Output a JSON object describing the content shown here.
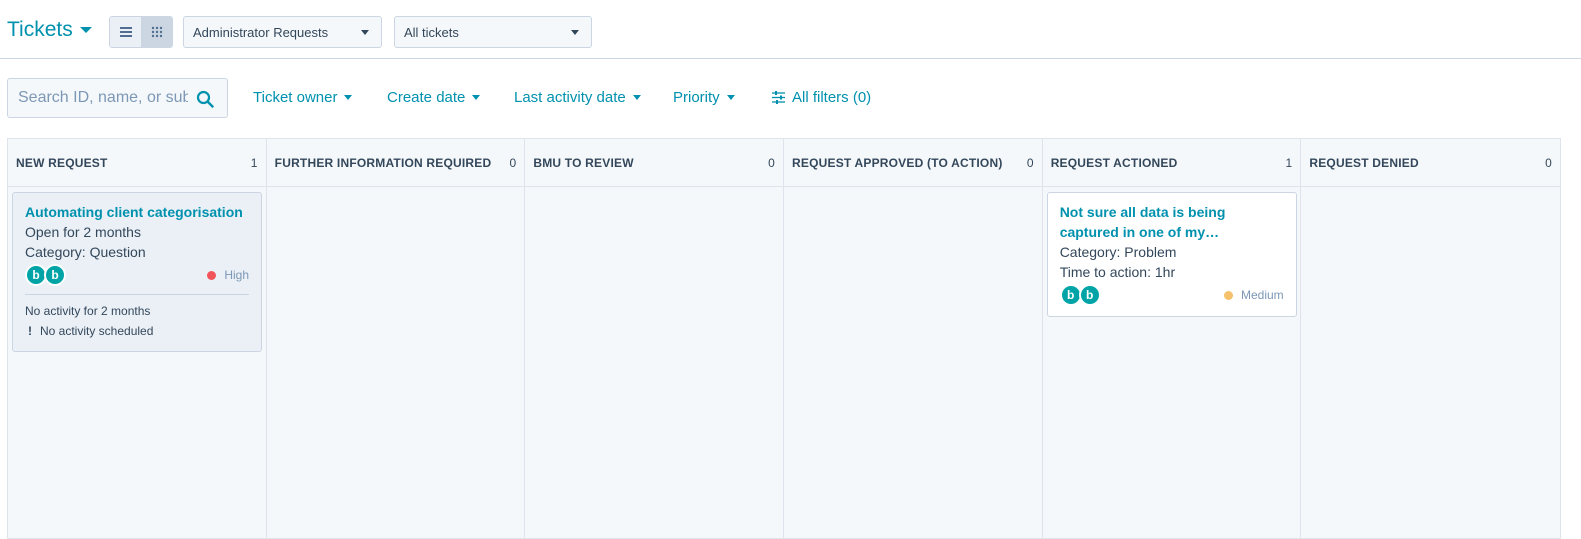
{
  "header": {
    "title": "Tickets",
    "pipeline_select": "Administrator Requests",
    "view_select": "All tickets"
  },
  "filters": {
    "search_placeholder": "Search ID, name, or subject",
    "items": [
      "Ticket owner",
      "Create date",
      "Last activity date",
      "Priority"
    ],
    "all_filters": "All filters (0)"
  },
  "columns": [
    {
      "label": "NEW REQUEST",
      "count": "1"
    },
    {
      "label": "FURTHER INFORMATION REQUIRED",
      "count": "0"
    },
    {
      "label": "BMU TO REVIEW",
      "count": "0"
    },
    {
      "label": "REQUEST APPROVED (TO ACTION)",
      "count": "0"
    },
    {
      "label": "REQUEST ACTIONED",
      "count": "1"
    },
    {
      "label": "REQUEST DENIED",
      "count": "0"
    }
  ],
  "cards": [
    {
      "title": "Automating client categorisation",
      "open_for": "Open for 2 months",
      "category_label": "Category:",
      "category_value": "Question",
      "avatar_a": "b",
      "avatar_b": "b",
      "priority": "High",
      "priority_color": "#f2545b",
      "activity": "No activity for 2 months",
      "scheduled": "No activity scheduled",
      "scheduled_icon": "!"
    },
    {
      "title": "Not sure all data is being captured in one of my…",
      "category_label": "Category:",
      "category_value": "Problem",
      "time_label": "Time to action:",
      "time_value": "1hr",
      "avatar_a": "b",
      "avatar_b": "b",
      "priority": "Medium",
      "priority_color": "#f5c26b"
    }
  ],
  "colors": {
    "accent": "#0091ae",
    "text": "#33475b",
    "border": "#cbd6e2",
    "board_bg": "#f5f8fa"
  }
}
